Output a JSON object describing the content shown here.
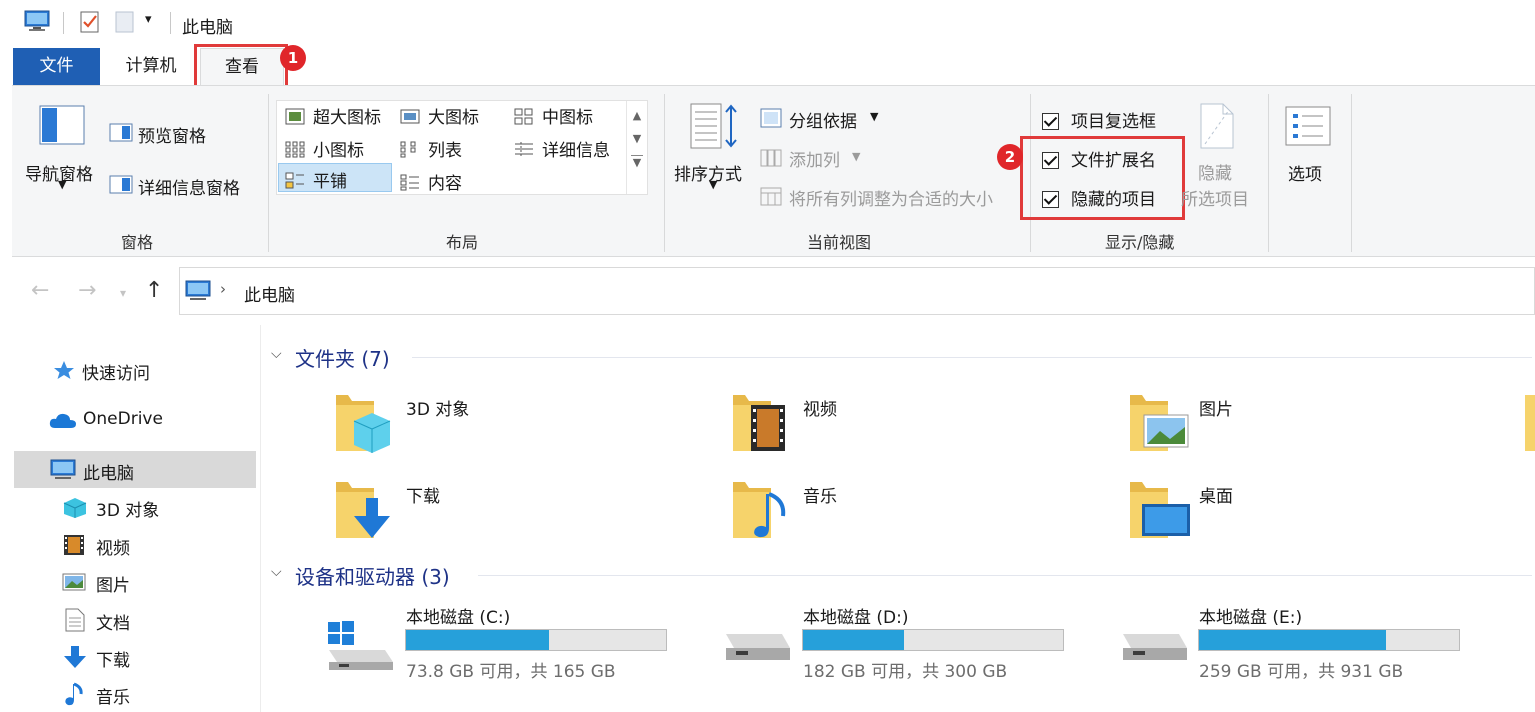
{
  "window": {
    "title": "此电脑"
  },
  "tabs": [
    {
      "label": "文件"
    },
    {
      "label": "计算机"
    },
    {
      "label": "查看"
    }
  ],
  "badges": {
    "step1": "1",
    "step2": "2"
  },
  "ribbon": {
    "panes": {
      "nav": "导航窗格",
      "preview": "预览窗格",
      "details": "详细信息窗格",
      "group": "窗格"
    },
    "layout": {
      "items": [
        "超大图标",
        "大图标",
        "中图标",
        "小图标",
        "列表",
        "详细信息",
        "平铺",
        "内容"
      ],
      "selected": "平铺",
      "group": "布局"
    },
    "current_view": {
      "sort": "排序方式",
      "group_by": "分组依据",
      "add_column": "添加列",
      "fit_columns": "将所有列调整为合适的大小",
      "group": "当前视图"
    },
    "show_hide": {
      "item_checkboxes": {
        "label": "项目复选框",
        "checked": true
      },
      "file_extensions": {
        "label": "文件扩展名",
        "checked": true
      },
      "hidden_items": {
        "label": "隐藏的项目",
        "checked": true
      },
      "hide_selected_line1": "隐藏",
      "hide_selected_line2": "所选项目",
      "group": "显示/隐藏"
    },
    "options": "选项"
  },
  "address": {
    "path": "此电脑"
  },
  "nav_pane": {
    "quick_access": "快速访问",
    "onedrive": "OneDrive",
    "this_pc": "此电脑",
    "children": [
      "3D 对象",
      "视频",
      "图片",
      "文档",
      "下载",
      "音乐"
    ]
  },
  "content": {
    "folders_header": "文件夹 (7)",
    "folders": [
      "3D 对象",
      "视频",
      "图片",
      "下载",
      "音乐",
      "桌面"
    ],
    "devices_header": "设备和驱动器 (3)",
    "drives": [
      {
        "name": "本地磁盘 (C:)",
        "free": "73.8 GB 可用，共 165 GB",
        "used_fraction": 0.55
      },
      {
        "name": "本地磁盘 (D:)",
        "free": "182 GB 可用，共 300 GB",
        "used_fraction": 0.39
      },
      {
        "name": "本地磁盘 (E:)",
        "free": "259 GB 可用，共 931 GB",
        "used_fraction": 0.72
      }
    ]
  },
  "colors": {
    "accent": "#1f5fb4",
    "highlight": "#e03a3a",
    "drive_bar": "#26a0da",
    "section_header": "#1e3287"
  }
}
